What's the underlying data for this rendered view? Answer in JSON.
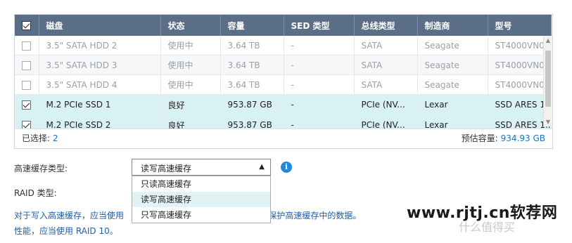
{
  "table": {
    "columns": [
      "磁盘",
      "状态",
      "容量",
      "SED 类型",
      "总线类型",
      "制造商",
      "型号"
    ],
    "rows": [
      {
        "checked": false,
        "disabled": true,
        "disk": "3.5\" SATA HDD 2",
        "status": "使用中",
        "capacity": "3.64 TB",
        "sed": "-",
        "bus": "SATA",
        "vendor": "Seagate",
        "model": "ST4000VN0..."
      },
      {
        "checked": false,
        "disabled": true,
        "disk": "3.5\" SATA HDD 3",
        "status": "使用中",
        "capacity": "3.64 TB",
        "sed": "-",
        "bus": "SATA",
        "vendor": "Seagate",
        "model": "ST4000VN0..."
      },
      {
        "checked": false,
        "disabled": true,
        "disk": "3.5\" SATA HDD 4",
        "status": "使用中",
        "capacity": "3.64 TB",
        "sed": "-",
        "bus": "SATA",
        "vendor": "Seagate",
        "model": "ST4000VN0..."
      },
      {
        "checked": true,
        "disabled": false,
        "disk": "M.2 PCIe SSD 1",
        "status": "良好",
        "capacity": "953.87 GB",
        "sed": "-",
        "bus": "PCIe (NV...",
        "vendor": "Lexar",
        "model": "SSD ARES 1..."
      },
      {
        "checked": true,
        "disabled": false,
        "disk": "M.2 PCIe SSD 2",
        "status": "良好",
        "capacity": "953.87 GB",
        "sed": "-",
        "bus": "PCIe (NV...",
        "vendor": "Lexar",
        "model": "SSD ARES 1..."
      }
    ],
    "selected_label": "已选择:",
    "selected_count": "2",
    "estimated_label": "预估容量:",
    "estimated_value": "934.93 GB"
  },
  "cache_type": {
    "label": "高速缓存类型:",
    "value": "读写高速缓存",
    "options": [
      "只读高速缓存",
      "读写高速缓存",
      "只写高速缓存"
    ],
    "active_option": "读写高速缓存"
  },
  "raid": {
    "label": "RAID 类型:"
  },
  "description": {
    "line1_a": "对于写入高速缓存，应当使用",
    "line1_b": "5、10) 来保护高速缓存中的数据。",
    "line2": "性能，应当使用 RAID 10。"
  },
  "watermark": {
    "main": "www.rjtj.cn软荐网",
    "sub": "什么值得买"
  }
}
